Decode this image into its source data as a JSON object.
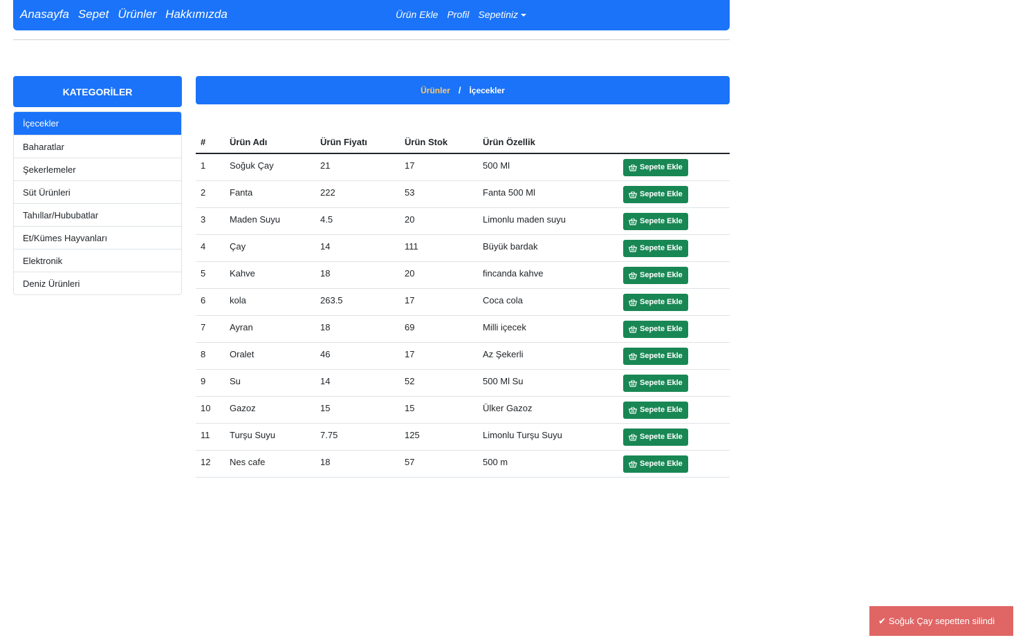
{
  "navbar": {
    "left_links": [
      "Anasayfa",
      "Sepet",
      "Ürünler",
      "Hakkımızda"
    ],
    "right_links": [
      "Ürün Ekle",
      "Profil"
    ],
    "cart_dropdown": "Sepetiniz"
  },
  "sidebar": {
    "header": "KATEGORİLER",
    "items": [
      {
        "label": "İçecekler",
        "active": true
      },
      {
        "label": "Baharatlar",
        "active": false
      },
      {
        "label": "Şekerlemeler",
        "active": false
      },
      {
        "label": "Süt Ürünleri",
        "active": false
      },
      {
        "label": "Tahıllar/Hububatlar",
        "active": false
      },
      {
        "label": "Et/Kümes Hayvanları",
        "active": false
      },
      {
        "label": "Elektronik",
        "active": false
      },
      {
        "label": "Deniz Ürünleri",
        "active": false
      }
    ]
  },
  "breadcrumb": {
    "link": "Ürünler",
    "separator": "/",
    "current": "İçecekler"
  },
  "table": {
    "headers": [
      "#",
      "Ürün Adı",
      "Ürün Fiyatı",
      "Ürün Stok",
      "Ürün Özellik",
      ""
    ],
    "add_button_label": "Sepete Ekle",
    "rows": [
      {
        "id": "1",
        "name": "Soğuk Çay",
        "price": "21",
        "stock": "17",
        "feature": "500 Ml"
      },
      {
        "id": "2",
        "name": "Fanta",
        "price": "222",
        "stock": "53",
        "feature": "Fanta 500 Ml"
      },
      {
        "id": "3",
        "name": "Maden Suyu",
        "price": "4.5",
        "stock": "20",
        "feature": "Limonlu maden suyu"
      },
      {
        "id": "4",
        "name": "Çay",
        "price": "14",
        "stock": "111",
        "feature": "Büyük bardak"
      },
      {
        "id": "5",
        "name": "Kahve",
        "price": "18",
        "stock": "20",
        "feature": "fincanda kahve"
      },
      {
        "id": "6",
        "name": "kola",
        "price": "263.5",
        "stock": "17",
        "feature": "Coca cola"
      },
      {
        "id": "7",
        "name": "Ayran",
        "price": "18",
        "stock": "69",
        "feature": "Milli içecek"
      },
      {
        "id": "8",
        "name": "Oralet",
        "price": "46",
        "stock": "17",
        "feature": "Az Şekerli"
      },
      {
        "id": "9",
        "name": "Su",
        "price": "14",
        "stock": "52",
        "feature": "500 Ml Su"
      },
      {
        "id": "10",
        "name": "Gazoz",
        "price": "15",
        "stock": "15",
        "feature": "Ülker Gazoz"
      },
      {
        "id": "11",
        "name": "Turşu Suyu",
        "price": "7.75",
        "stock": "125",
        "feature": "Limonlu Turşu Suyu"
      },
      {
        "id": "12",
        "name": "Nes cafe",
        "price": "18",
        "stock": "57",
        "feature": "500 m"
      }
    ]
  },
  "toast": {
    "icon": "check-icon",
    "message": "Soğuk Çay sepetten silindi"
  },
  "colors": {
    "primary": "#1a73f8",
    "success": "#198754",
    "toast_bg": "#e06565",
    "breadcrumb_link": "#ffc870"
  }
}
